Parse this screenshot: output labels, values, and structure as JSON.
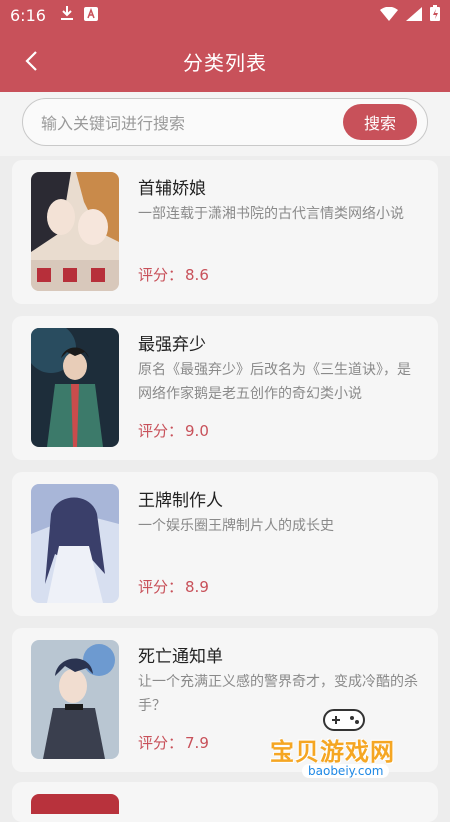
{
  "status_bar": {
    "time": "6:16"
  },
  "header": {
    "title": "分类列表"
  },
  "search": {
    "placeholder": "输入关键词进行搜索",
    "button_label": "搜索"
  },
  "rating_prefix": "评分：",
  "books": [
    {
      "title": "首辅娇娘",
      "desc": "一部连载于潇湘书院的古代言情类网络小说",
      "rating": "8.6"
    },
    {
      "title": "最强弃少",
      "desc": "原名《最强弃少》后改名为《三生道诀》，是网络作家鹅是老五创作的奇幻类小说",
      "rating": "9.0"
    },
    {
      "title": "王牌制作人",
      "desc": "一个娱乐圈王牌制片人的成长史",
      "rating": "8.9"
    },
    {
      "title": "死亡通知单",
      "desc": "让一个充满正义感的警界奇才，变成冷酷的杀手？",
      "rating": "7.9"
    }
  ],
  "watermark": {
    "name": "宝贝游戏网",
    "url": "baobeiy.com"
  },
  "colors": {
    "accent": "#c8515a",
    "rating": "#c8515a"
  }
}
